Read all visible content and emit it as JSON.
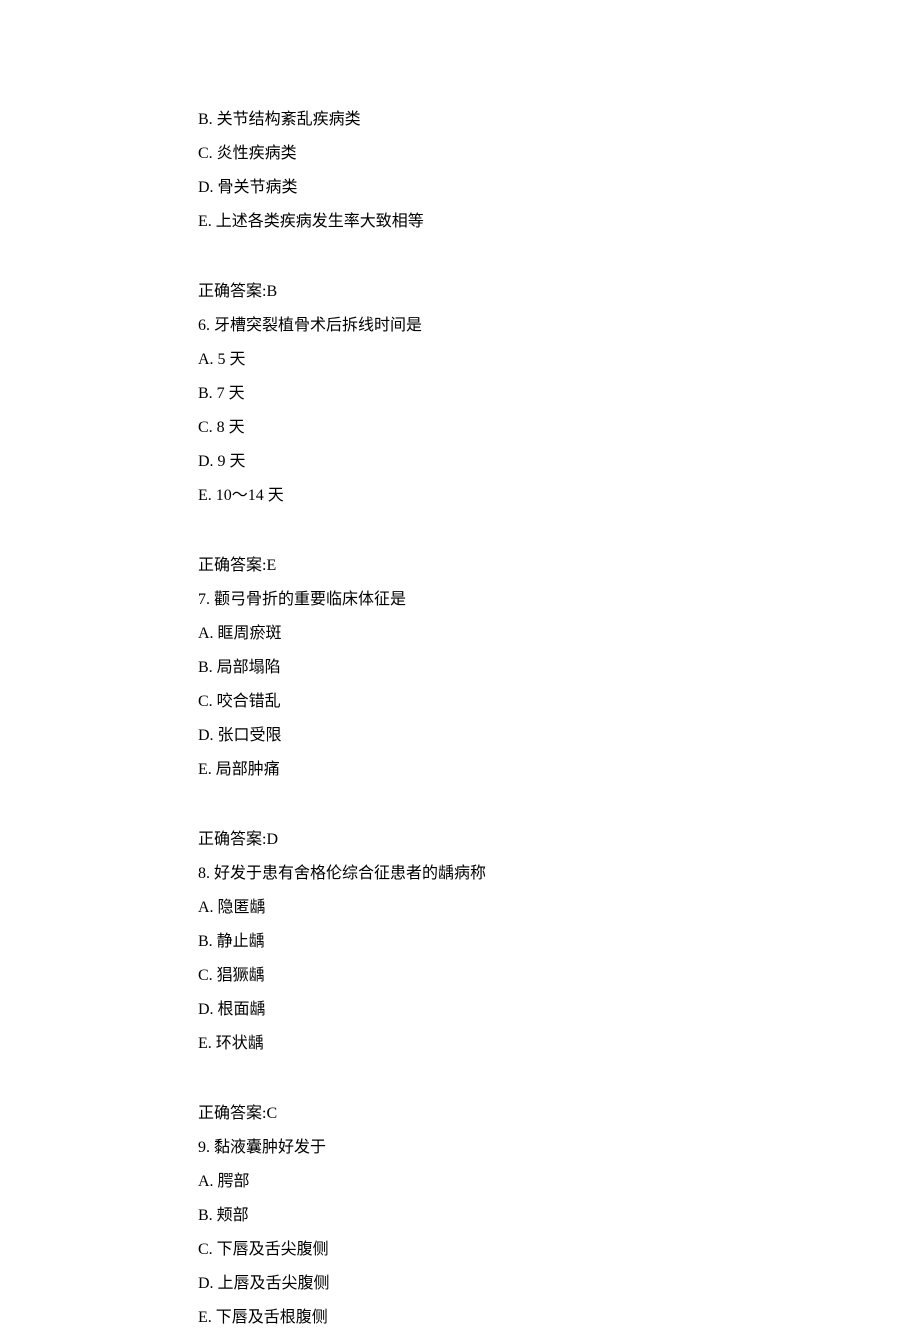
{
  "q5_tail": {
    "options": {
      "B": "B. 关节结构紊乱疾病类",
      "C": "C. 炎性疾病类",
      "D": "D. 骨关节病类",
      "E": "E. 上述各类疾病发生率大致相等"
    },
    "answer": "正确答案:B"
  },
  "q6": {
    "stem": "6. 牙槽突裂植骨术后拆线时间是",
    "options": {
      "A": "A. 5 天",
      "B": "B. 7 天",
      "C": "C. 8 天",
      "D": "D. 9 天",
      "E": "E. 10～14 天"
    },
    "answer": "正确答案:E"
  },
  "q7": {
    "stem": "7. 颧弓骨折的重要临床体征是",
    "options": {
      "A": "A. 眶周瘀斑",
      "B": "B. 局部塌陷",
      "C": "C. 咬合错乱",
      "D": "D. 张口受限",
      "E": "E. 局部肿痛"
    },
    "answer": "正确答案:D"
  },
  "q8": {
    "stem": "8. 好发于患有舍格伦综合征患者的龋病称",
    "options": {
      "A": "A. 隐匿龋",
      "B": "B. 静止龋",
      "C": "C. 猖獗龋",
      "D": "D. 根面龋",
      "E": "E. 环状龋"
    },
    "answer": "正确答案:C"
  },
  "q9": {
    "stem": "9. 黏液囊肿好发于",
    "options": {
      "A": "A. 腭部",
      "B": "B. 颊部",
      "C": "C. 下唇及舌尖腹侧",
      "D": "D. 上唇及舌尖腹侧",
      "E": "E. 下唇及舌根腹侧"
    }
  }
}
